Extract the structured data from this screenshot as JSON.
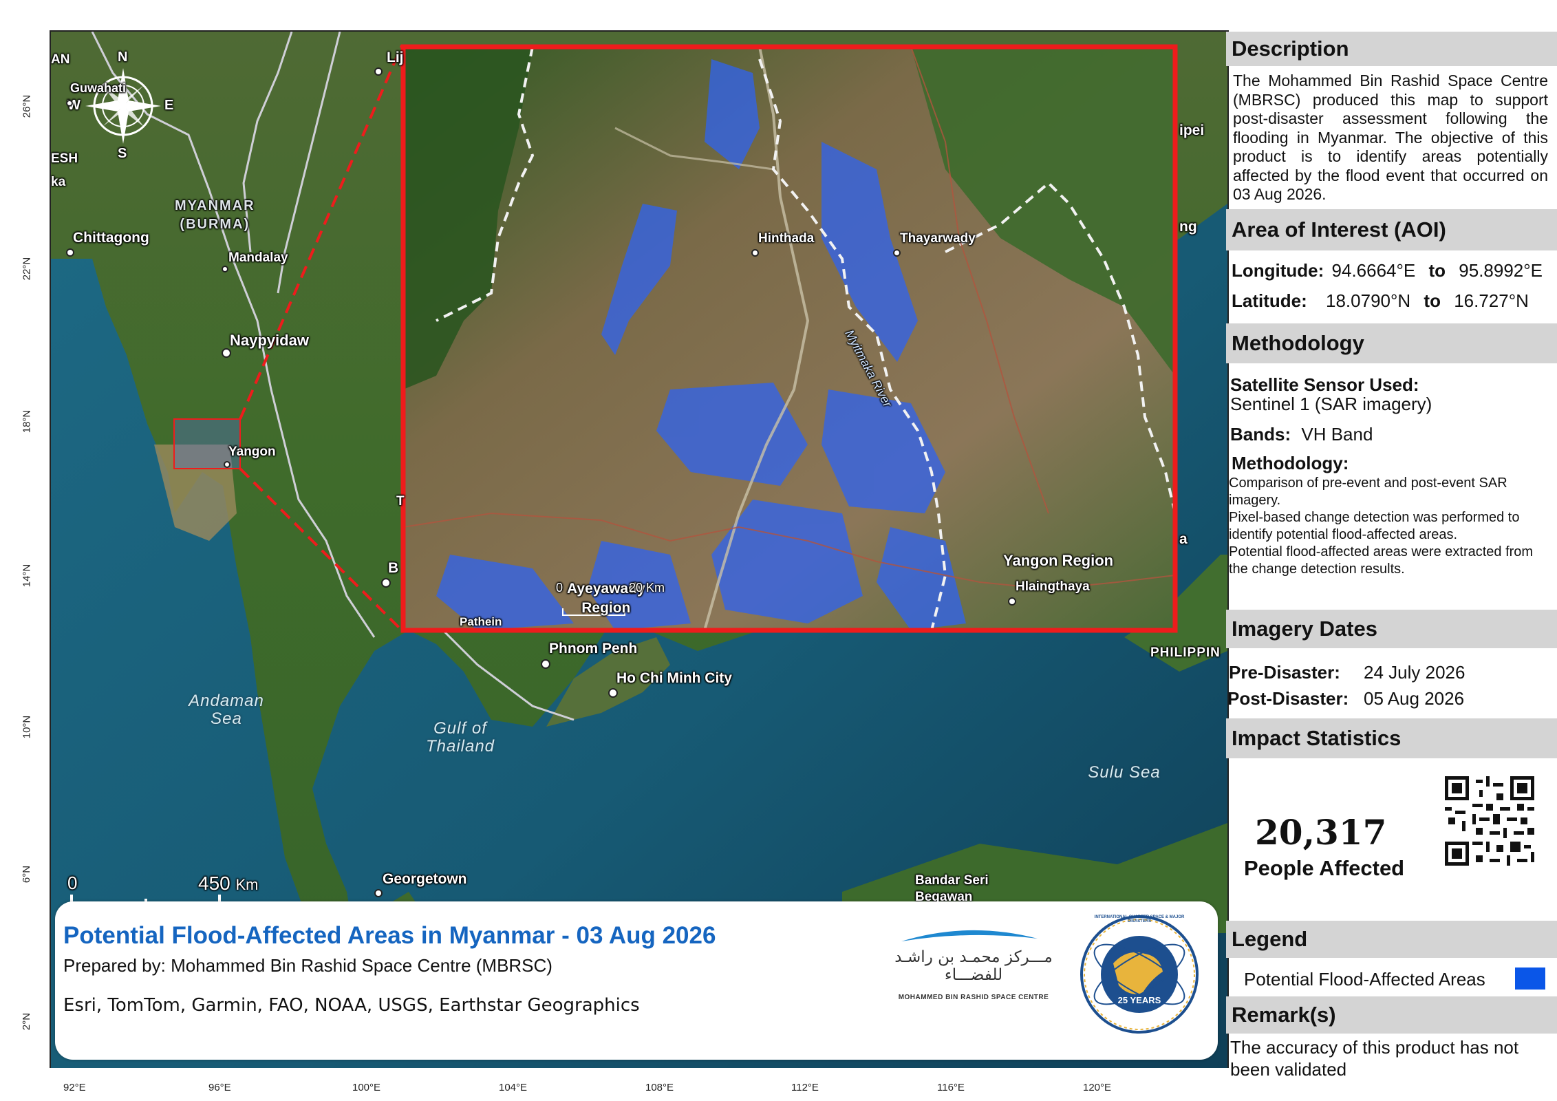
{
  "map": {
    "country_label": "MYANMAR\n(BURMA)",
    "cities": [
      {
        "name": "Guwahati"
      },
      {
        "name": "Chittagong"
      },
      {
        "name": "Mandalay"
      },
      {
        "name": "Naypyidaw"
      },
      {
        "name": "Yangon"
      },
      {
        "name": "Lij"
      },
      {
        "name": "Phnom Penh"
      },
      {
        "name": "Ho Chi Minh City"
      },
      {
        "name": "Georgetown"
      },
      {
        "name": "Bandar Seri Begawan"
      },
      {
        "name": "B"
      }
    ],
    "partial_labels": [
      "AN",
      "ESH",
      "ka",
      "ipei",
      "ng",
      "a",
      "PHILIPPIN",
      "T"
    ],
    "seas": [
      {
        "name": "Andaman\nSea"
      },
      {
        "name": "Gulf of\nThailand"
      },
      {
        "name": "Sulu Sea"
      }
    ],
    "compass": {
      "n": "N",
      "s": "S",
      "e": "E",
      "w": "W"
    },
    "scale_bar": {
      "zero": "0",
      "distance": "450",
      "unit": "Km"
    },
    "lat_labels": [
      "26°N",
      "22°N",
      "18°N",
      "14°N",
      "10°N",
      "6°N",
      "2°N"
    ],
    "lon_labels": [
      "92°E",
      "96°E",
      "100°E",
      "104°E",
      "108°E",
      "112°E",
      "116°E",
      "120°E"
    ]
  },
  "inset": {
    "places": [
      {
        "name": "Hinthada"
      },
      {
        "name": "Thayarwady"
      },
      {
        "name": "Yangon Region"
      },
      {
        "name": "Hlaingthaya"
      },
      {
        "name": "Ayeyawady\nRegion"
      },
      {
        "name": "Pathein"
      }
    ],
    "river": "Myitmaka River",
    "scale_bar": {
      "zero": "0",
      "distance": "20",
      "unit": "Km"
    }
  },
  "title_box": {
    "title": "Potential Flood-Affected Areas in Myanmar - 03 Aug 2026",
    "prepared_by": "Prepared by: Mohammed Bin Rashid Space Centre (MBRSC)",
    "credits": "Esri, TomTom, Garmin, FAO, NOAA, USGS, Earthstar Geographics",
    "mbrsc_logo_arabic": "مـــركز محمـد بن راشـد للفضـــاء",
    "mbrsc_logo_english": "MOHAMMED BIN RASHID SPACE CENTRE",
    "charter_logo_text": "INTERNATIONAL CHARTER SPACE & MAJOR DISASTERS",
    "charter_logo_badge": "25 YEARS"
  },
  "panel": {
    "description": {
      "heading": "Description",
      "text": "The Mohammed Bin Rashid Space Centre (MBRSC) produced this map to support post-disaster assessment following the flooding in Myanmar. The objective of this product is to identify areas potentially affected by the flood event that occurred on 03 Aug 2026."
    },
    "aoi": {
      "heading": "Area of Interest (AOI)",
      "longitude_label": "Longitude:",
      "longitude_from": "94.6664°E",
      "longitude_to": "95.8992°E",
      "latitude_label": "Latitude:",
      "latitude_from": "18.0790°N",
      "latitude_to": "16.727°N",
      "to_word": "to"
    },
    "methodology": {
      "heading": "Methodology",
      "sensor_label": "Satellite Sensor Used:",
      "sensor_value": "Sentinel 1 (SAR imagery)",
      "bands_label": "Bands:",
      "bands_value": "VH Band",
      "method_label": "Methodology:",
      "steps": [
        "Comparison of pre-event and post-event SAR imagery.",
        "Pixel-based change detection was performed to identify potential flood-affected areas.",
        "Potential flood-affected areas were extracted from the change detection results."
      ]
    },
    "imagery": {
      "heading": "Imagery Dates",
      "pre_label": "Pre-Disaster:",
      "pre_value": "24 July 2026",
      "post_label": "Post-Disaster:",
      "post_value": "05 Aug 2026"
    },
    "impact": {
      "heading": "Impact Statistics",
      "people_affected": "20,317",
      "caption": "People Affected"
    },
    "legend": {
      "heading": "Legend",
      "item_label": "Potential Flood-Affected Areas",
      "item_color": "#0a56e8"
    },
    "remarks": {
      "heading": "Remark(s)",
      "text": "The accuracy of this product has not been validated"
    }
  },
  "colors": {
    "title_blue": "#1565c0",
    "inset_border": "#ee1c1c",
    "flood": "#2f63f0",
    "section_grey": "#d4d4d4"
  }
}
